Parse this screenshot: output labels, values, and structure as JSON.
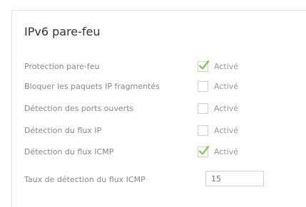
{
  "panel": {
    "title": "IPv6 pare-feu"
  },
  "rows": [
    {
      "label": "Protection pare-feu",
      "checked": true,
      "option_label": "Activé"
    },
    {
      "label": "Bloquer les paquets IP fragmentés",
      "checked": false,
      "option_label": "Activé"
    },
    {
      "label": "Détection des ports ouverts",
      "checked": false,
      "option_label": "Activé"
    },
    {
      "label": "Détection du flux IP",
      "checked": false,
      "option_label": "Activé"
    },
    {
      "label": "Détection du flux ICMP",
      "checked": true,
      "option_label": "Activé"
    }
  ],
  "icmp_rate": {
    "label": "Taux de détection du flux ICMP",
    "value": "15"
  },
  "colors": {
    "checkmark": "#7cc243",
    "border": "#cfcfcf"
  }
}
